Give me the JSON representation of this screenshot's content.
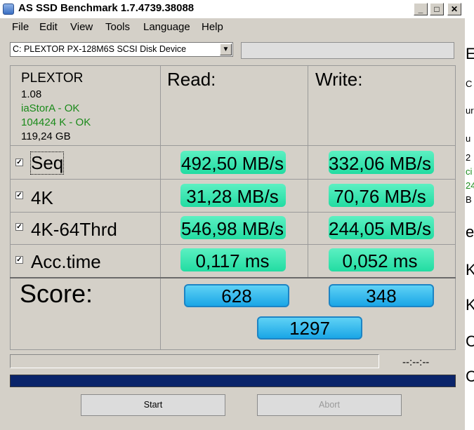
{
  "window": {
    "title": "AS SSD Benchmark 1.7.4739.38088",
    "minimize_glyph": "_",
    "maximize_glyph": "□",
    "close_glyph": "✕"
  },
  "menu": [
    "File",
    "Edit",
    "View",
    "Tools",
    "Language",
    "Help"
  ],
  "device_select": {
    "value": "C: PLEXTOR PX-128M6S SCSI Disk Device",
    "arrow": "▼"
  },
  "drive_info": {
    "brand": "PLEXTOR",
    "firmware": "1.08",
    "driver": "iaStorA - OK",
    "alignment": "104424 K - OK",
    "size": "119,24 GB",
    "ok_color": "#1a8a1a"
  },
  "columns": {
    "read": "Read:",
    "write": "Write:"
  },
  "rows": [
    {
      "label": "Seq",
      "checked": "✓",
      "read": "492,50 MB/s",
      "write": "332,06 MB/s"
    },
    {
      "label": "4K",
      "checked": "✓",
      "read": "31,28 MB/s",
      "write": "70,76 MB/s"
    },
    {
      "label": "4K-64Thrd",
      "checked": "✓",
      "read": "546,98 MB/s",
      "write": "244,05 MB/s"
    },
    {
      "label": "Acc.time",
      "checked": "✓",
      "read": "0,117 ms",
      "write": "0,052 ms"
    }
  ],
  "score": {
    "label": "Score:",
    "read": "628",
    "write": "348",
    "total": "1297"
  },
  "status": {
    "time": "--:--:--"
  },
  "buttons": {
    "start": "Start",
    "abort": "Abort"
  },
  "colors": {
    "green_bar": "#22dca2",
    "blue_bar": "#1aa6e6",
    "progress_bar": "#0a246a"
  },
  "background_window_fragments": [
    "E",
    "C",
    "ur",
    "u",
    "2",
    "ci",
    "24",
    "B",
    "e",
    "K",
    "K",
    "C",
    "C"
  ]
}
